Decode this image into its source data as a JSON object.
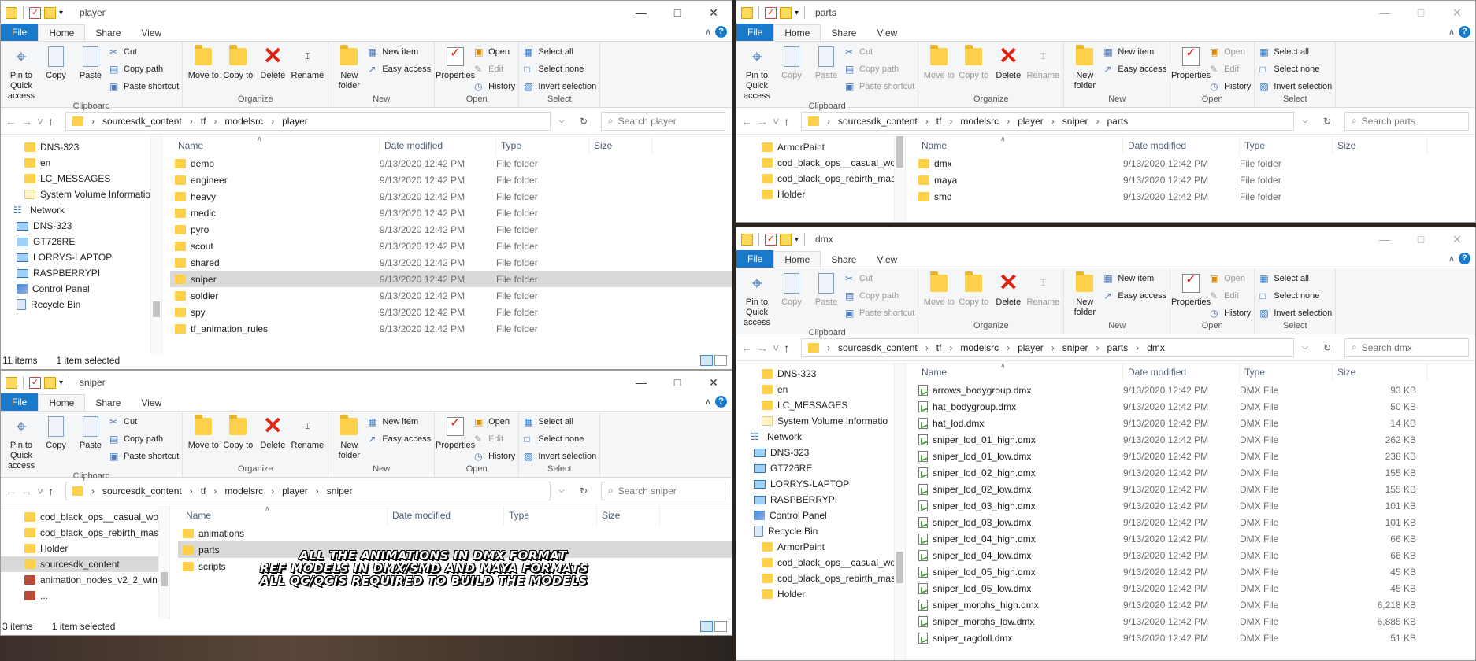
{
  "ribbon": {
    "tabs": [
      "File",
      "Home",
      "Share",
      "View"
    ],
    "groups": {
      "clipboard": "Clipboard",
      "organize": "Organize",
      "new": "New",
      "open": "Open",
      "select": "Select"
    },
    "pin": "Pin to Quick access",
    "copy": "Copy",
    "paste": "Paste",
    "cut": "Cut",
    "copy_path": "Copy path",
    "paste_shortcut": "Paste shortcut",
    "move_to": "Move to",
    "copy_to": "Copy to",
    "delete": "Delete",
    "rename": "Rename",
    "new_folder": "New folder",
    "new_item": "New item",
    "easy_access": "Easy access",
    "properties": "Properties",
    "open": "Open",
    "edit": "Edit",
    "history": "History",
    "select_all": "Select all",
    "select_none": "Select none",
    "invert_selection": "Invert selection"
  },
  "columns": {
    "name": "Name",
    "date": "Date modified",
    "type": "Type",
    "size": "Size"
  },
  "player": {
    "title": "player",
    "breadcrumb": [
      "sourcesdk_content",
      "tf",
      "modelsrc",
      "player"
    ],
    "search_placeholder": "Search player",
    "nav": [
      {
        "label": "DNS-323",
        "icon": "folder"
      },
      {
        "label": "en",
        "icon": "folder"
      },
      {
        "label": "LC_MESSAGES",
        "icon": "folder"
      },
      {
        "label": "System Volume Informatio",
        "icon": "folder-pale"
      },
      {
        "label": "Network",
        "icon": "network"
      },
      {
        "label": "DNS-323",
        "icon": "pc"
      },
      {
        "label": "GT726RE",
        "icon": "pc"
      },
      {
        "label": "LORRYS-LAPTOP",
        "icon": "pc"
      },
      {
        "label": "RASPBERRYPI",
        "icon": "pc"
      },
      {
        "label": "Control Panel",
        "icon": "control"
      },
      {
        "label": "Recycle Bin",
        "icon": "bin"
      }
    ],
    "rows": [
      {
        "name": "demo",
        "date": "9/13/2020 12:42 PM",
        "type": "File folder"
      },
      {
        "name": "engineer",
        "date": "9/13/2020 12:42 PM",
        "type": "File folder"
      },
      {
        "name": "heavy",
        "date": "9/13/2020 12:42 PM",
        "type": "File folder"
      },
      {
        "name": "medic",
        "date": "9/13/2020 12:42 PM",
        "type": "File folder"
      },
      {
        "name": "pyro",
        "date": "9/13/2020 12:42 PM",
        "type": "File folder"
      },
      {
        "name": "scout",
        "date": "9/13/2020 12:42 PM",
        "type": "File folder"
      },
      {
        "name": "shared",
        "date": "9/13/2020 12:42 PM",
        "type": "File folder"
      },
      {
        "name": "sniper",
        "date": "9/13/2020 12:42 PM",
        "type": "File folder",
        "selected": true
      },
      {
        "name": "soldier",
        "date": "9/13/2020 12:42 PM",
        "type": "File folder"
      },
      {
        "name": "spy",
        "date": "9/13/2020 12:42 PM",
        "type": "File folder"
      },
      {
        "name": "tf_animation_rules",
        "date": "9/13/2020 12:42 PM",
        "type": "File folder"
      }
    ],
    "status_items": "11 items",
    "status_selected": "1 item selected"
  },
  "sniper": {
    "title": "sniper",
    "breadcrumb": [
      "sourcesdk_content",
      "tf",
      "modelsrc",
      "player",
      "sniper"
    ],
    "search_placeholder": "Search sniper",
    "nav": [
      {
        "label": "cod_black_ops__casual_woo",
        "icon": "folder"
      },
      {
        "label": "cod_black_ops_rebirth_masc",
        "icon": "folder"
      },
      {
        "label": "Holder",
        "icon": "folder"
      },
      {
        "label": "sourcesdk_content",
        "icon": "folder",
        "selected": true
      },
      {
        "label": "animation_nodes_v2_2_winc",
        "icon": "archive"
      },
      {
        "label": "...",
        "icon": "archive"
      }
    ],
    "rows": [
      {
        "name": "animations"
      },
      {
        "name": "parts",
        "selected": true
      },
      {
        "name": "scripts"
      }
    ],
    "annotation": [
      "ALL THE ANIMATIONS IN DMX FORMAT",
      "REF MODELS IN DMX/SMD AND MAYA FORMATS",
      "ALL QC/QCIS REQUIRED TO BUILD THE MODELS"
    ],
    "status_items": "3 items",
    "status_selected": "1 item selected"
  },
  "parts": {
    "title": "parts",
    "breadcrumb": [
      "sourcesdk_content",
      "tf",
      "modelsrc",
      "player",
      "sniper",
      "parts"
    ],
    "search_placeholder": "Search parts",
    "nav": [
      {
        "label": "ArmorPaint",
        "icon": "folder"
      },
      {
        "label": "cod_black_ops__casual_woo",
        "icon": "folder"
      },
      {
        "label": "cod_black_ops_rebirth_masc",
        "icon": "folder"
      },
      {
        "label": "Holder",
        "icon": "folder"
      }
    ],
    "rows": [
      {
        "name": "dmx",
        "date": "9/13/2020 12:42 PM",
        "type": "File folder"
      },
      {
        "name": "maya",
        "date": "9/13/2020 12:42 PM",
        "type": "File folder"
      },
      {
        "name": "smd",
        "date": "9/13/2020 12:42 PM",
        "type": "File folder"
      }
    ]
  },
  "dmx": {
    "title": "dmx",
    "breadcrumb": [
      "sourcesdk_content",
      "tf",
      "modelsrc",
      "player",
      "sniper",
      "parts",
      "dmx"
    ],
    "search_placeholder": "Search dmx",
    "nav": [
      {
        "label": "DNS-323",
        "icon": "folder"
      },
      {
        "label": "en",
        "icon": "folder"
      },
      {
        "label": "LC_MESSAGES",
        "icon": "folder"
      },
      {
        "label": "System Volume Informatio",
        "icon": "folder-pale"
      },
      {
        "label": "Network",
        "icon": "network"
      },
      {
        "label": "DNS-323",
        "icon": "pc"
      },
      {
        "label": "GT726RE",
        "icon": "pc"
      },
      {
        "label": "LORRYS-LAPTOP",
        "icon": "pc"
      },
      {
        "label": "RASPBERRYPI",
        "icon": "pc"
      },
      {
        "label": "Control Panel",
        "icon": "control"
      },
      {
        "label": "Recycle Bin",
        "icon": "bin"
      },
      {
        "label": "ArmorPaint",
        "icon": "folder"
      },
      {
        "label": "cod_black_ops__casual_woo",
        "icon": "folder"
      },
      {
        "label": "cod_black_ops_rebirth_masc",
        "icon": "folder"
      },
      {
        "label": "Holder",
        "icon": "folder"
      }
    ],
    "rows": [
      {
        "name": "arrows_bodygroup.dmx",
        "date": "9/13/2020 12:42 PM",
        "type": "DMX File",
        "size": "93 KB"
      },
      {
        "name": "hat_bodygroup.dmx",
        "date": "9/13/2020 12:42 PM",
        "type": "DMX File",
        "size": "50 KB"
      },
      {
        "name": "hat_lod.dmx",
        "date": "9/13/2020 12:42 PM",
        "type": "DMX File",
        "size": "14 KB"
      },
      {
        "name": "sniper_lod_01_high.dmx",
        "date": "9/13/2020 12:42 PM",
        "type": "DMX File",
        "size": "262 KB"
      },
      {
        "name": "sniper_lod_01_low.dmx",
        "date": "9/13/2020 12:42 PM",
        "type": "DMX File",
        "size": "238 KB"
      },
      {
        "name": "sniper_lod_02_high.dmx",
        "date": "9/13/2020 12:42 PM",
        "type": "DMX File",
        "size": "155 KB"
      },
      {
        "name": "sniper_lod_02_low.dmx",
        "date": "9/13/2020 12:42 PM",
        "type": "DMX File",
        "size": "155 KB"
      },
      {
        "name": "sniper_lod_03_high.dmx",
        "date": "9/13/2020 12:42 PM",
        "type": "DMX File",
        "size": "101 KB"
      },
      {
        "name": "sniper_lod_03_low.dmx",
        "date": "9/13/2020 12:42 PM",
        "type": "DMX File",
        "size": "101 KB"
      },
      {
        "name": "sniper_lod_04_high.dmx",
        "date": "9/13/2020 12:42 PM",
        "type": "DMX File",
        "size": "66 KB"
      },
      {
        "name": "sniper_lod_04_low.dmx",
        "date": "9/13/2020 12:42 PM",
        "type": "DMX File",
        "size": "66 KB"
      },
      {
        "name": "sniper_lod_05_high.dmx",
        "date": "9/13/2020 12:42 PM",
        "type": "DMX File",
        "size": "45 KB"
      },
      {
        "name": "sniper_lod_05_low.dmx",
        "date": "9/13/2020 12:42 PM",
        "type": "DMX File",
        "size": "45 KB"
      },
      {
        "name": "sniper_morphs_high.dmx",
        "date": "9/13/2020 12:42 PM",
        "type": "DMX File",
        "size": "6,218 KB"
      },
      {
        "name": "sniper_morphs_low.dmx",
        "date": "9/13/2020 12:42 PM",
        "type": "DMX File",
        "size": "6,885 KB"
      },
      {
        "name": "sniper_ragdoll.dmx",
        "date": "9/13/2020 12:42 PM",
        "type": "DMX File",
        "size": "51 KB"
      }
    ]
  }
}
